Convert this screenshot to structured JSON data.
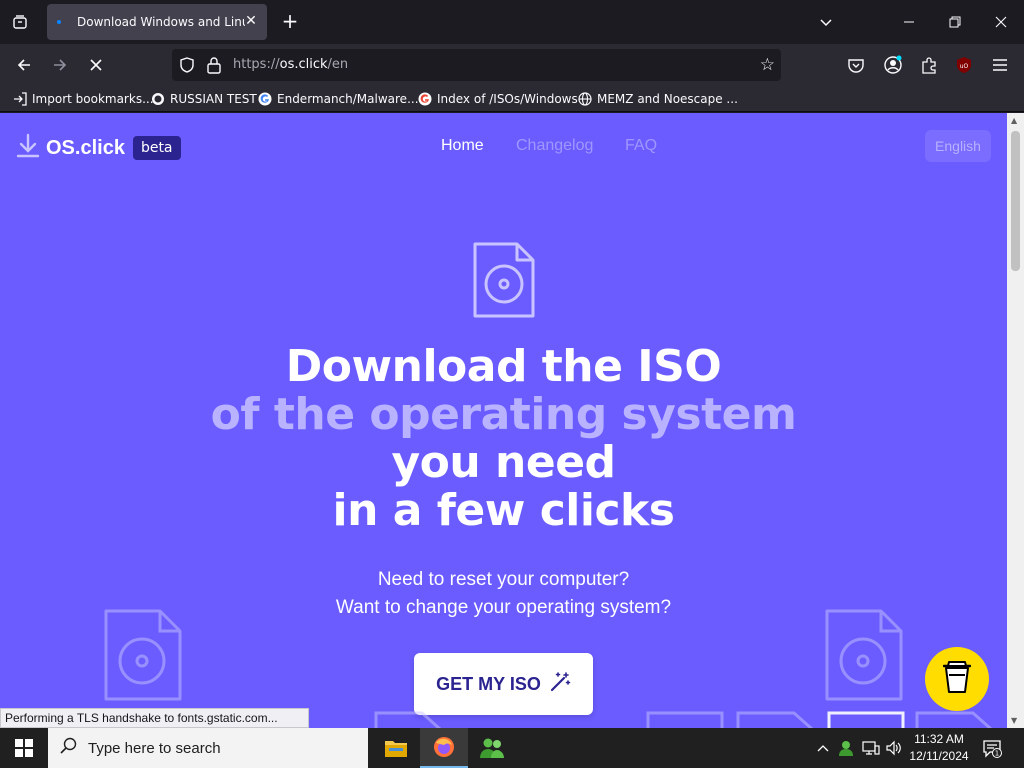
{
  "browser": {
    "tab_title": "Download Windows and Linux ISO",
    "url_scheme": "https://",
    "url_host": "os.click",
    "url_path": "/en",
    "bookmarks": [
      {
        "label": "Import bookmarks...",
        "icon": "import-icon"
      },
      {
        "label": "RUSSIAN TEST",
        "icon": "github-icon"
      },
      {
        "label": "Endermanch/Malware...",
        "icon": "google-icon"
      },
      {
        "label": "Index of /ISOs/Windows",
        "icon": "google-icon"
      },
      {
        "label": "MEMZ and Noescape ...",
        "icon": "globe-icon"
      }
    ],
    "status_text": "Performing a TLS handshake to fonts.gstatic.com..."
  },
  "site": {
    "brand": "OS.click",
    "badge": "beta",
    "nav": {
      "home": "Home",
      "changelog": "Changelog",
      "faq": "FAQ"
    },
    "language": "English",
    "headline": {
      "line1": "Download the ISO",
      "line2": "of the operating system",
      "line3": "you need",
      "line4": "in a few clicks"
    },
    "sub1": "Need to reset your computer?",
    "sub2": "Want to change your operating system?",
    "cta": "GET MY ISO",
    "colors": {
      "background": "#6a5cff",
      "accent_dark": "#2b2390",
      "coffee": "#ffdd00"
    }
  },
  "taskbar": {
    "search_placeholder": "Type here to search",
    "time": "11:32 AM",
    "date": "12/11/2024",
    "notification_count": "1"
  }
}
